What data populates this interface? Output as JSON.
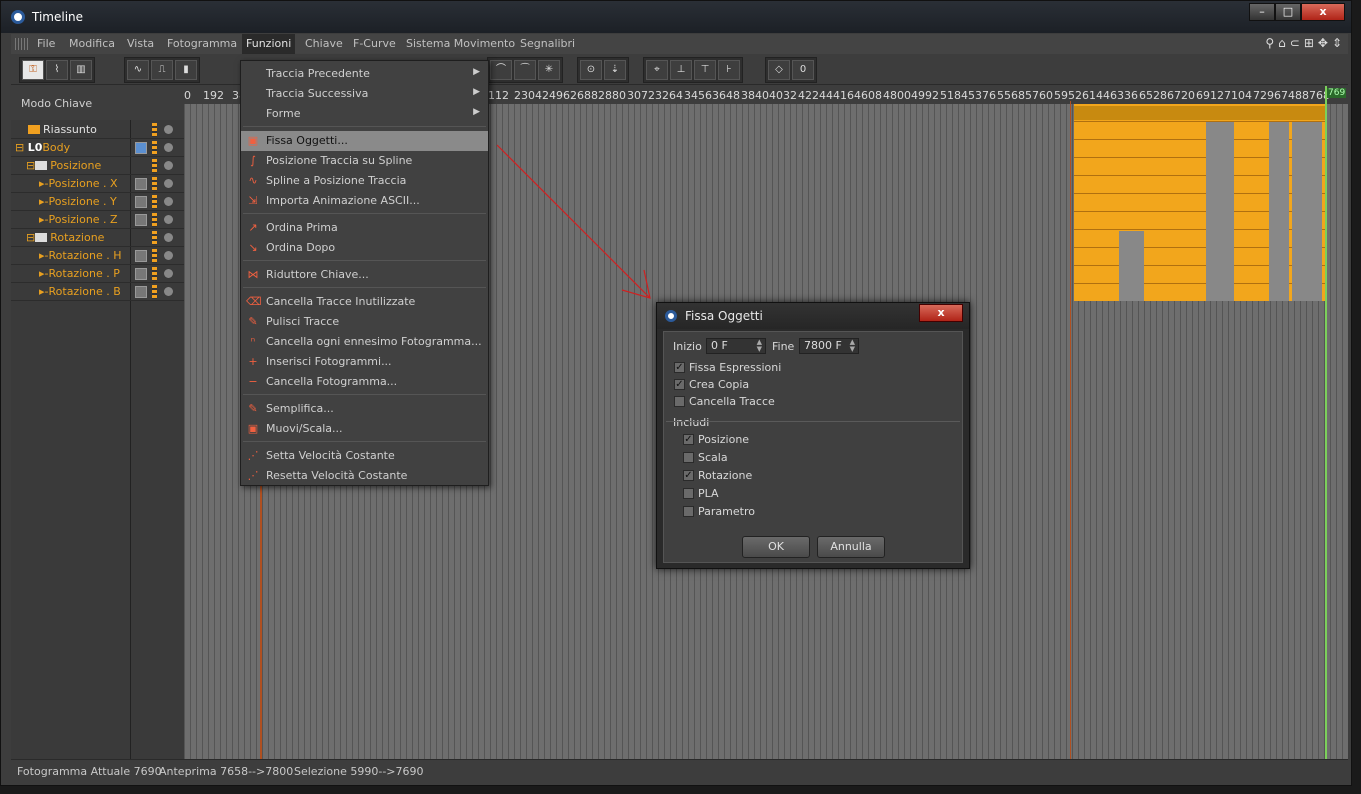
{
  "window": {
    "title": "Timeline"
  },
  "menubar": [
    "File",
    "Modifica",
    "Vista",
    "Fotogramma",
    "Funzioni",
    "Chiave",
    "F-Curve",
    "Sistema Movimento",
    "Segnalibri"
  ],
  "left_panel": {
    "mode": "Modo Chiave",
    "rows": [
      "Riassunto",
      "Body",
      "Posizione",
      "Posizione . X",
      "Posizione . Y",
      "Posizione . Z",
      "Rotazione",
      "Rotazione . H",
      "Rotazione . P",
      "Rotazione . B"
    ]
  },
  "ruler": {
    "ticks": [
      "0",
      "192",
      "38",
      "2112",
      "2304",
      "2496",
      "2688",
      "2880",
      "3072",
      "3264",
      "3456",
      "3648",
      "3840",
      "4032",
      "4224",
      "4416",
      "4608",
      "4800",
      "4992",
      "5184",
      "5376",
      "5568",
      "5760",
      "5952",
      "6144",
      "6336",
      "6528",
      "6720",
      "6912",
      "7104",
      "7296",
      "7488",
      "768"
    ],
    "playhead": "769"
  },
  "dropdown": [
    "Traccia Precedente",
    "Traccia Successiva",
    "Forme",
    "Fissa Oggetti...",
    "Posizione Traccia su Spline",
    "Spline a Posizione Traccia",
    "Importa Animazione ASCII...",
    "Ordina Prima",
    "Ordina Dopo",
    "Riduttore Chiave...",
    "Cancella Tracce Inutilizzate",
    "Pulisci Tracce",
    "Cancella ogni ennesimo Fotogramma...",
    "Inserisci Fotogrammi...",
    "Cancella Fotogramma...",
    "Semplifica...",
    "Muovi/Scala...",
    "Setta Velocità Costante",
    "Resetta Velocità Costante"
  ],
  "dialog": {
    "title": "Fissa Oggetti",
    "close": "x",
    "inizio_label": "Inizio",
    "inizio_value": "0 F",
    "fine_label": "Fine",
    "fine_value": "7800 F",
    "opts": [
      "Fissa Espressioni",
      "Crea Copia",
      "Cancella Tracce"
    ],
    "includi_label": "Includi",
    "includi": [
      "Posizione",
      "Scala",
      "Rotazione",
      "PLA",
      "Parametro"
    ],
    "ok": "OK",
    "cancel": "Annulla"
  },
  "status": {
    "current": "Fotogramma Attuale  7690",
    "preview": "Anteprima  7658-->7800",
    "selection": "Selezione  5990-->7690"
  }
}
